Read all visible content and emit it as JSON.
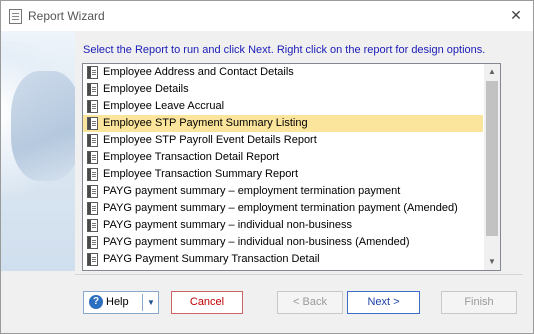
{
  "window": {
    "title": "Report Wizard",
    "close_glyph": "✕"
  },
  "instruction": "Select the Report to run and click Next.  Right click on the report for design options.",
  "reports": [
    {
      "label": "Employee Address and Contact Details",
      "selected": false
    },
    {
      "label": "Employee Details",
      "selected": false
    },
    {
      "label": "Employee Leave Accrual",
      "selected": false
    },
    {
      "label": "Employee STP Payment Summary Listing",
      "selected": true
    },
    {
      "label": "Employee STP Payroll Event Details Report",
      "selected": false
    },
    {
      "label": "Employee Transaction Detail Report",
      "selected": false
    },
    {
      "label": "Employee Transaction Summary Report",
      "selected": false
    },
    {
      "label": "PAYG payment summary – employment termination payment",
      "selected": false
    },
    {
      "label": "PAYG payment summary – employment termination payment (Amended)",
      "selected": false
    },
    {
      "label": "PAYG payment summary – individual non-business",
      "selected": false
    },
    {
      "label": "PAYG payment summary – individual non-business (Amended)",
      "selected": false
    },
    {
      "label": "PAYG Payment Summary Transaction Detail",
      "selected": false
    }
  ],
  "scrollbar": {
    "up_glyph": "▲",
    "down_glyph": "▼"
  },
  "buttons": {
    "help": "Help",
    "help_icon_glyph": "?",
    "help_dropdown_glyph": "▼",
    "cancel": "Cancel",
    "back": "< Back",
    "next": "Next >",
    "finish": "Finish"
  },
  "colors": {
    "selection": "#fbe49b",
    "instruction_text": "#1b1bb8",
    "cancel_text": "#c00000",
    "next_text": "#1a3fa8"
  }
}
